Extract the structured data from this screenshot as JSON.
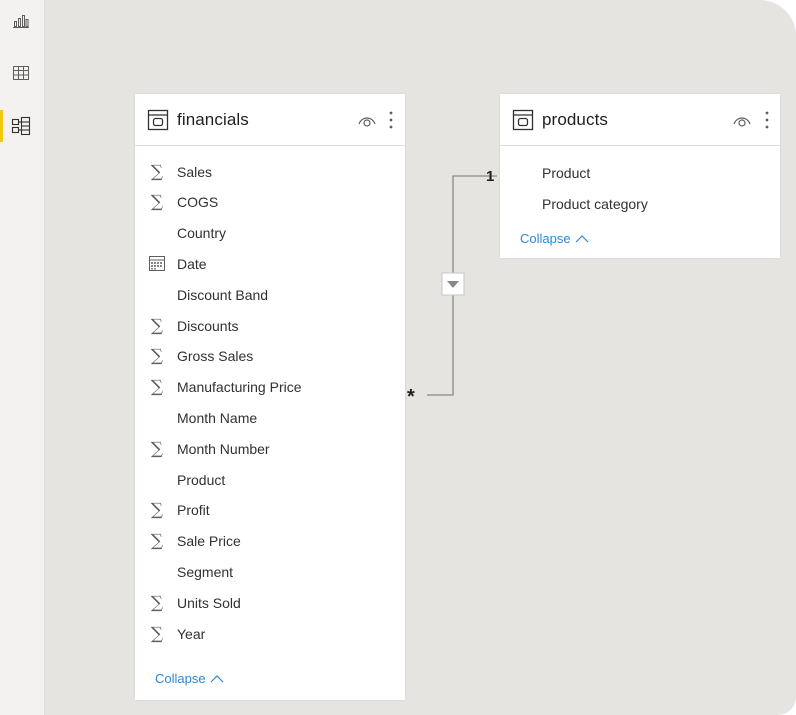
{
  "left_rail": {
    "items": [
      {
        "name": "report-view",
        "icon": "bar-chart-icon"
      },
      {
        "name": "data-view",
        "icon": "table-grid-icon"
      },
      {
        "name": "model-view",
        "icon": "model-diagram-icon",
        "active": true
      }
    ],
    "accent_color": "#f2c811"
  },
  "tables": {
    "financials": {
      "title": "financials",
      "fields": [
        {
          "label": "Sales",
          "icon": "sigma"
        },
        {
          "label": "COGS",
          "icon": "sigma"
        },
        {
          "label": "Country",
          "icon": "none"
        },
        {
          "label": "Date",
          "icon": "calendar"
        },
        {
          "label": "Discount Band",
          "icon": "none"
        },
        {
          "label": "Discounts",
          "icon": "sigma"
        },
        {
          "label": "Gross Sales",
          "icon": "sigma"
        },
        {
          "label": "Manufacturing Price",
          "icon": "sigma"
        },
        {
          "label": "Month Name",
          "icon": "none"
        },
        {
          "label": "Month Number",
          "icon": "sigma"
        },
        {
          "label": "Product",
          "icon": "none"
        },
        {
          "label": "Profit",
          "icon": "sigma"
        },
        {
          "label": "Sale Price",
          "icon": "sigma"
        },
        {
          "label": "Segment",
          "icon": "none"
        },
        {
          "label": "Units Sold",
          "icon": "sigma"
        },
        {
          "label": "Year",
          "icon": "sigma"
        }
      ],
      "collapse_label": "Collapse"
    },
    "products": {
      "title": "products",
      "fields": [
        {
          "label": "Product",
          "icon": "none"
        },
        {
          "label": "Product category",
          "icon": "none"
        }
      ],
      "collapse_label": "Collapse"
    }
  },
  "relationship": {
    "from_table": "financials",
    "to_table": "products",
    "many_side_label": "*",
    "one_side_label": "1",
    "filter_direction": "single"
  },
  "colors": {
    "canvas": "#e6e4e1",
    "link": "#2b88d8",
    "relationship_line": "#8a8886"
  }
}
